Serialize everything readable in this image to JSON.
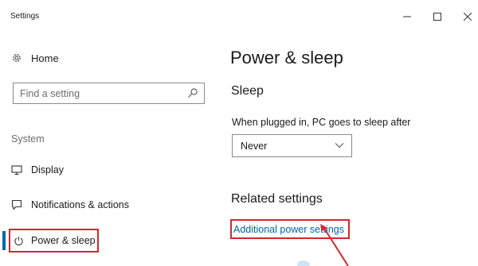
{
  "window": {
    "title": "Settings",
    "controls": {
      "minimize": "minimize-icon",
      "maximize": "maximize-icon",
      "close": "close-icon"
    }
  },
  "sidebar": {
    "home": {
      "label": "Home",
      "icon": "gear-icon"
    },
    "search": {
      "placeholder": "Find a setting",
      "icon": "search-icon"
    },
    "group_label": "System",
    "items": [
      {
        "label": "Display",
        "icon": "monitor-icon",
        "active": false
      },
      {
        "label": "Notifications & actions",
        "icon": "notification-icon",
        "active": false
      },
      {
        "label": "Power & sleep",
        "icon": "power-icon",
        "active": true
      }
    ]
  },
  "main": {
    "title": "Power & sleep",
    "sleep_section": {
      "heading": "Sleep",
      "label": "When plugged in, PC goes to sleep after",
      "dropdown_value": "Never"
    },
    "related": {
      "heading": "Related settings",
      "link": "Additional power settings"
    }
  },
  "colors": {
    "accent": "#0063b1",
    "highlight": "#d6262d",
    "link": "#0063b1"
  }
}
